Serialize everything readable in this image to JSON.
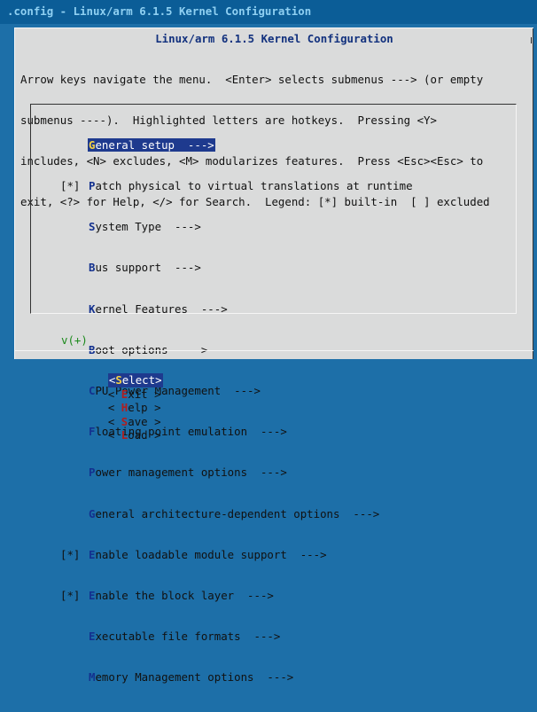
{
  "window": {
    "title": ".config - Linux/arm 6.1.5 Kernel Configuration"
  },
  "dialog": {
    "title": "Linux/arm 6.1.5 Kernel Configuration",
    "help_lines": [
      "Arrow keys navigate the menu.  <Enter> selects submenus ---> (or empty",
      "submenus ----).  Highlighted letters are hotkeys.  Pressing <Y>",
      "includes, <N> excludes, <M> modularizes features.  Press <Esc><Esc> to",
      "exit, <?> for Help, </> for Search.  Legend: [*] built-in  [ ] excluded"
    ]
  },
  "menu": {
    "items": [
      {
        "check": "",
        "hotkey": "G",
        "rest": "eneral setup  --->",
        "selected": true
      },
      {
        "check": "[*]",
        "hotkey": "P",
        "rest": "atch physical to virtual translations at runtime"
      },
      {
        "check": "",
        "hotkey": "S",
        "rest": "ystem Type  --->"
      },
      {
        "check": "",
        "hotkey": "B",
        "rest": "us support  --->"
      },
      {
        "check": "",
        "hotkey": "K",
        "rest": "ernel Features  --->"
      },
      {
        "check": "",
        "hotkey": "B",
        "rest": "oot options  --->"
      },
      {
        "check": "",
        "hotkey": "C",
        "rest": "PU Power Management  --->"
      },
      {
        "check": "",
        "hotkey": "F",
        "rest": "loating point emulation  --->"
      },
      {
        "check": "",
        "hotkey": "P",
        "rest": "ower management options  --->"
      },
      {
        "check": "",
        "hotkey": "G",
        "rest": "eneral architecture-dependent options  --->"
      },
      {
        "check": "[*]",
        "hotkey": "E",
        "rest": "nable loadable module support  --->"
      },
      {
        "check": "[*]",
        "hotkey": "E",
        "rest": "nable the block layer  --->"
      },
      {
        "check": "",
        "hotkey": "E",
        "rest": "xecutable file formats  --->"
      },
      {
        "check": "",
        "hotkey": "M",
        "rest": "emory Management options  --->"
      }
    ],
    "more_indicator": "v(+)"
  },
  "buttons": {
    "select": {
      "pre": "<",
      "hot": "S",
      "post": "elect>"
    },
    "exit": {
      "pre": "< ",
      "hot": "E",
      "post": "xit >"
    },
    "help": {
      "pre": "< ",
      "hot": "H",
      "post": "elp >"
    },
    "save": {
      "pre": "< ",
      "hot": "S",
      "post": "ave >"
    },
    "load": {
      "pre": "< ",
      "hot": "L",
      "post": "oad >"
    }
  },
  "colors": {
    "background": "#1d6fa8",
    "dialog": "#dadbdb",
    "selection": "#1e3a8e",
    "selected_hotkey": "#f3d045",
    "hotkey": "#13318f",
    "button_hotkey": "#b01e1e",
    "more_indicator": "#1c8a1c"
  }
}
